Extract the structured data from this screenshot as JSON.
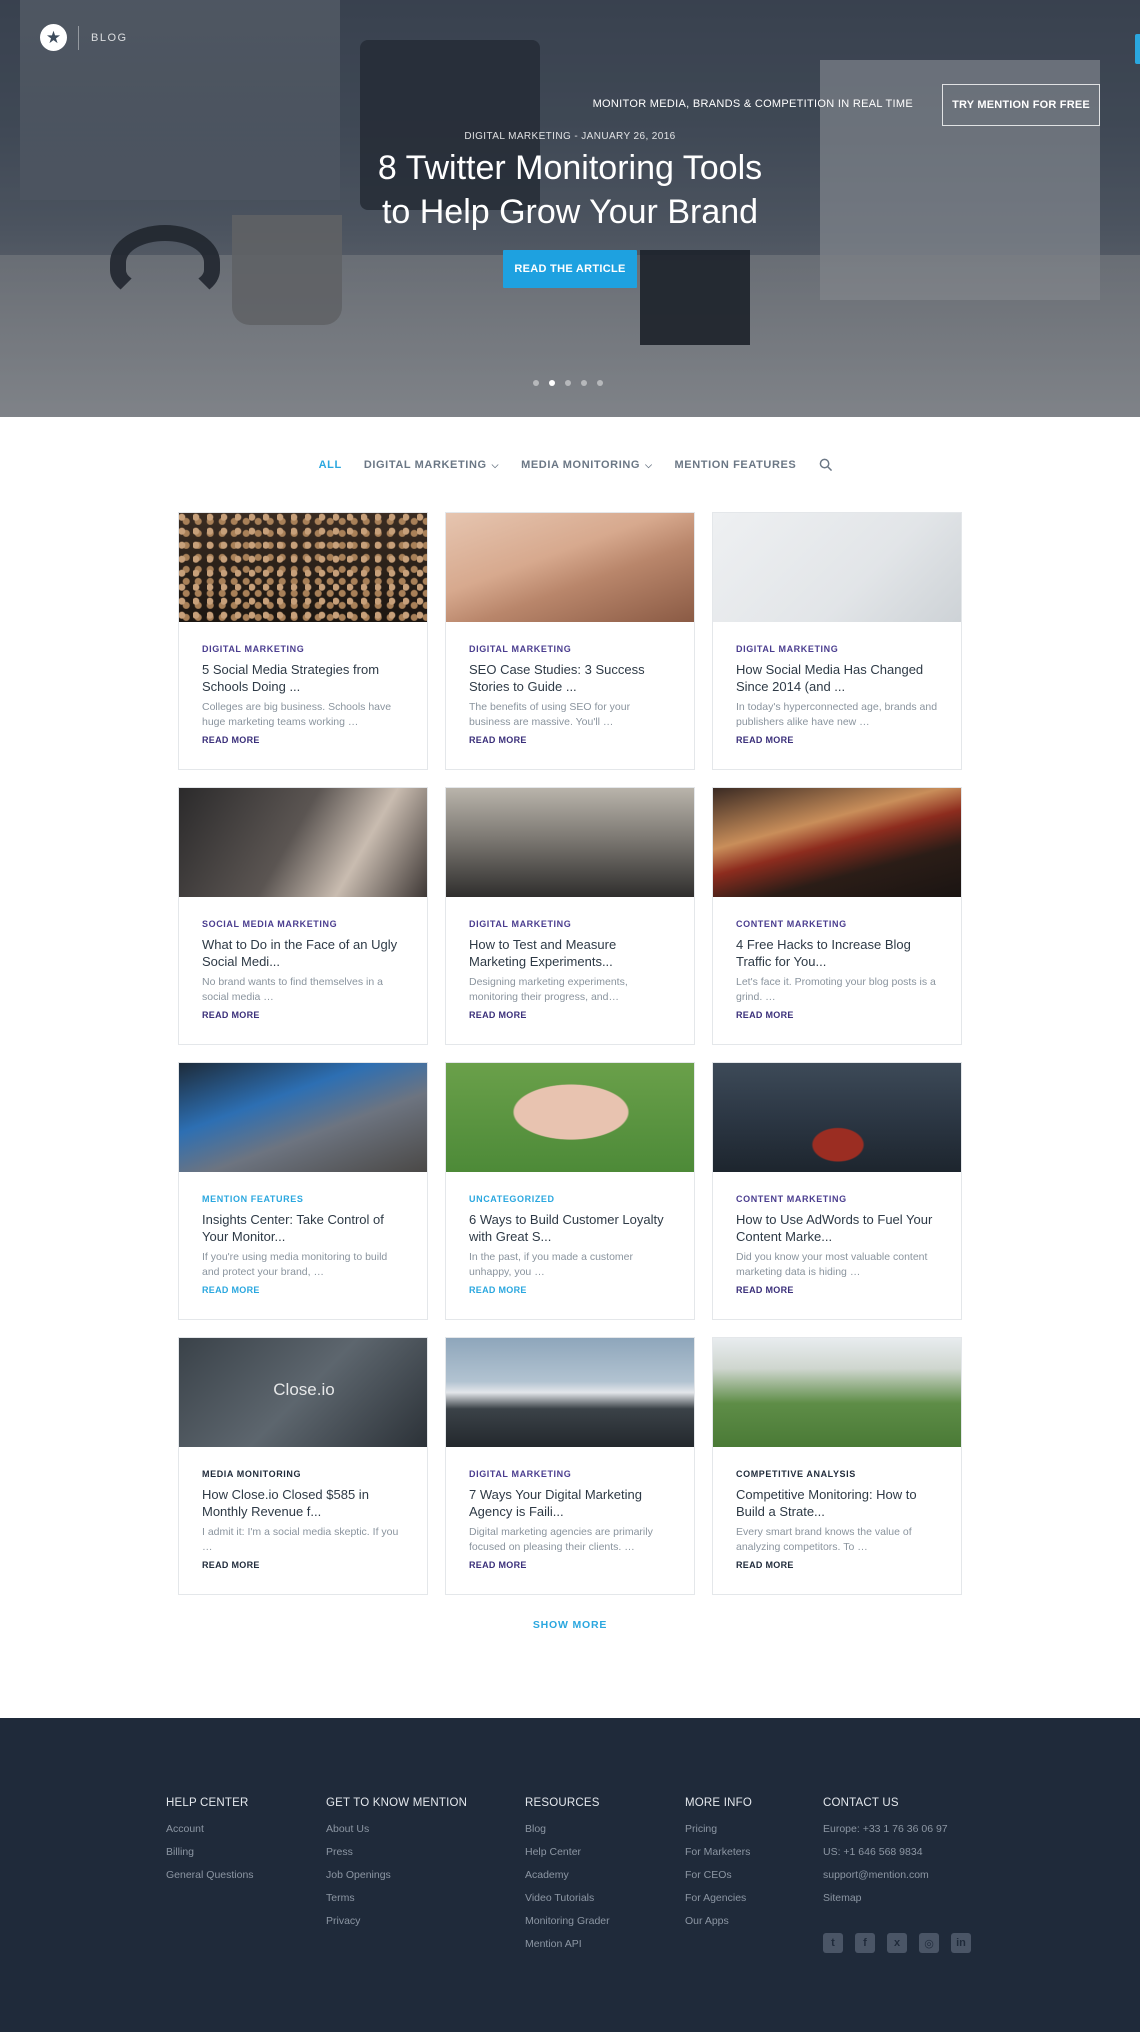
{
  "hero": {
    "logo_label": "BLOG",
    "tagline": "MONITOR MEDIA, BRANDS & COMPETITION IN REAL TIME",
    "try_button": "TRY MENTION FOR FREE",
    "meta": "DIGITAL MARKETING - JANUARY 26, 2016",
    "title_line1": "8 Twitter Monitoring Tools",
    "title_line2": "to Help Grow Your Brand",
    "read_button": "READ THE ARTICLE",
    "slides": 5,
    "active_slide": 2
  },
  "nav": {
    "items": [
      {
        "label": "ALL",
        "active": true,
        "dropdown": false
      },
      {
        "label": "DIGITAL MARKETING",
        "active": false,
        "dropdown": true
      },
      {
        "label": "MEDIA MONITORING",
        "active": false,
        "dropdown": true
      },
      {
        "label": "MENTION FEATURES",
        "active": false,
        "dropdown": false
      }
    ],
    "search_icon": "search-icon"
  },
  "cards": [
    {
      "category": "DIGITAL MARKETING",
      "cat_color": "#4a3d8f",
      "title": "5 Social Media Strategies from Schools Doing ...",
      "excerpt": "Colleges are big business. Schools have huge marketing teams working …",
      "more": "READ MORE",
      "more_color": "#3a2f7a",
      "image": "crowd"
    },
    {
      "category": "DIGITAL MARKETING",
      "cat_color": "#4a3d8f",
      "title": "SEO Case Studies: 3 Success Stories to Guide ...",
      "excerpt": "The benefits of using SEO for your business are massive. You'll …",
      "more": "READ MORE",
      "more_color": "#3a2f7a",
      "image": "desert"
    },
    {
      "category": "DIGITAL MARKETING",
      "cat_color": "#4a3d8f",
      "title": "How Social Media Has Changed Since 2014 (and ...",
      "excerpt": "In today's hyperconnected age, brands and publishers alike have new …",
      "more": "READ MORE",
      "more_color": "#3a2f7a",
      "image": "phone"
    },
    {
      "category": "SOCIAL MEDIA MARKETING",
      "cat_color": "#4a3d8f",
      "title": "What to Do in the Face of an Ugly Social Medi...",
      "excerpt": "No brand wants to find themselves in a social media …",
      "more": "READ MORE",
      "more_color": "#3a2f7a",
      "image": "office"
    },
    {
      "category": "DIGITAL MARKETING",
      "cat_color": "#4a3d8f",
      "title": "How to Test and Measure Marketing Experiments...",
      "excerpt": "Designing marketing experiments, monitoring their progress, and…",
      "more": "READ MORE",
      "more_color": "#3a2f7a",
      "image": "desk"
    },
    {
      "category": "CONTENT MARKETING",
      "cat_color": "#4a3d8f",
      "title": "4 Free Hacks to Increase Blog Traffic for You...",
      "excerpt": "Let's face it. Promoting your blog posts is a grind. …",
      "more": "READ MORE",
      "more_color": "#3a2f7a",
      "image": "lights"
    },
    {
      "category": "MENTION FEATURES",
      "cat_color": "#2aa7df",
      "title": "Insights Center: Take Control of Your Monitor...",
      "excerpt": "If you're using media monitoring to build and protect your brand, …",
      "more": "READ MORE",
      "more_color": "#2aa7df",
      "image": "laptop"
    },
    {
      "category": "UNCATEGORIZED",
      "cat_color": "#2aa7df",
      "title": "6 Ways to Build Customer Loyalty with Great S...",
      "excerpt": "In the past, if you made a customer unhappy, you …",
      "more": "READ MORE",
      "more_color": "#2aa7df",
      "image": "hands"
    },
    {
      "category": "CONTENT MARKETING",
      "cat_color": "#4a3d8f",
      "title": "How to Use AdWords to Fuel Your Content Marke...",
      "excerpt": "Did you know your most valuable content marketing data is hiding …",
      "more": "READ MORE",
      "more_color": "#3a2f7a",
      "image": "car"
    },
    {
      "category": "MEDIA MONITORING",
      "cat_color": "#1f2a3a",
      "title": "How Close.io Closed $585 in Monthly Revenue f...",
      "excerpt": "I admit it: I'm a social media skeptic. If you …",
      "more": "READ MORE",
      "more_color": "#1f2a3a",
      "image": "closeio",
      "image_text": "Close.io"
    },
    {
      "category": "DIGITAL MARKETING",
      "cat_color": "#4a3d8f",
      "title": "7 Ways Your Digital Marketing Agency is Faili...",
      "excerpt": "Digital marketing agencies are primarily focused on pleasing their clients. …",
      "more": "READ MORE",
      "more_color": "#3a2f7a",
      "image": "plane"
    },
    {
      "category": "COMPETITIVE ANALYSIS",
      "cat_color": "#1f2a3a",
      "title": "Competitive Monitoring: How to Build a Strate...",
      "excerpt": "Every smart brand knows the value of analyzing competitors. To …",
      "more": "READ MORE",
      "more_color": "#1f2a3a",
      "image": "horses"
    }
  ],
  "show_more": "SHOW MORE",
  "footer": {
    "columns": [
      {
        "heading": "HELP CENTER",
        "links": [
          "Account",
          "Billing",
          "General Questions"
        ]
      },
      {
        "heading": "GET TO KNOW MENTION",
        "links": [
          "About Us",
          "Press",
          "Job Openings",
          "Terms",
          "Privacy"
        ]
      },
      {
        "heading": "RESOURCES",
        "links": [
          "Blog",
          "Help Center",
          "Academy",
          "Video Tutorials",
          "Monitoring Grader",
          "Mention API"
        ]
      },
      {
        "heading": "MORE INFO",
        "links": [
          "Pricing",
          "For Marketers",
          "For CEOs",
          "For Agencies",
          "Our Apps"
        ]
      },
      {
        "heading": "CONTACT US",
        "links": [
          "Europe: +33 1 76 36 06 97",
          "US: +1 646 568 9834",
          "support@mention.com",
          "Sitemap"
        ]
      }
    ],
    "socials": [
      "twitter-icon",
      "facebook-icon",
      "xing-icon",
      "instagram-icon",
      "linkedin-icon"
    ]
  }
}
